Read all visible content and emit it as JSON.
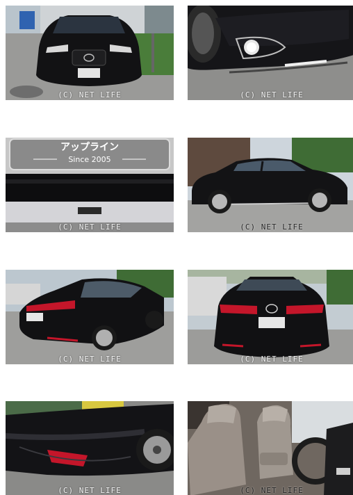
{
  "watermark": "(C) NET LIFE",
  "photos": [
    {
      "subject": "front view of black sedan"
    },
    {
      "subject": "front bumper fog lamp detail"
    },
    {
      "subject": "dealer plate and rear bumper detail",
      "plate_text": "Since 2005"
    },
    {
      "subject": "side view of black sedan"
    },
    {
      "subject": "rear three-quarter view"
    },
    {
      "subject": "rear view"
    },
    {
      "subject": "rear bumper and wheel detail"
    },
    {
      "subject": "interior front seats"
    }
  ],
  "colors": {
    "car_body": "#121214",
    "taillight": "#c4162a",
    "asphalt": "#8c8c8c",
    "interior": "#9a9088"
  }
}
